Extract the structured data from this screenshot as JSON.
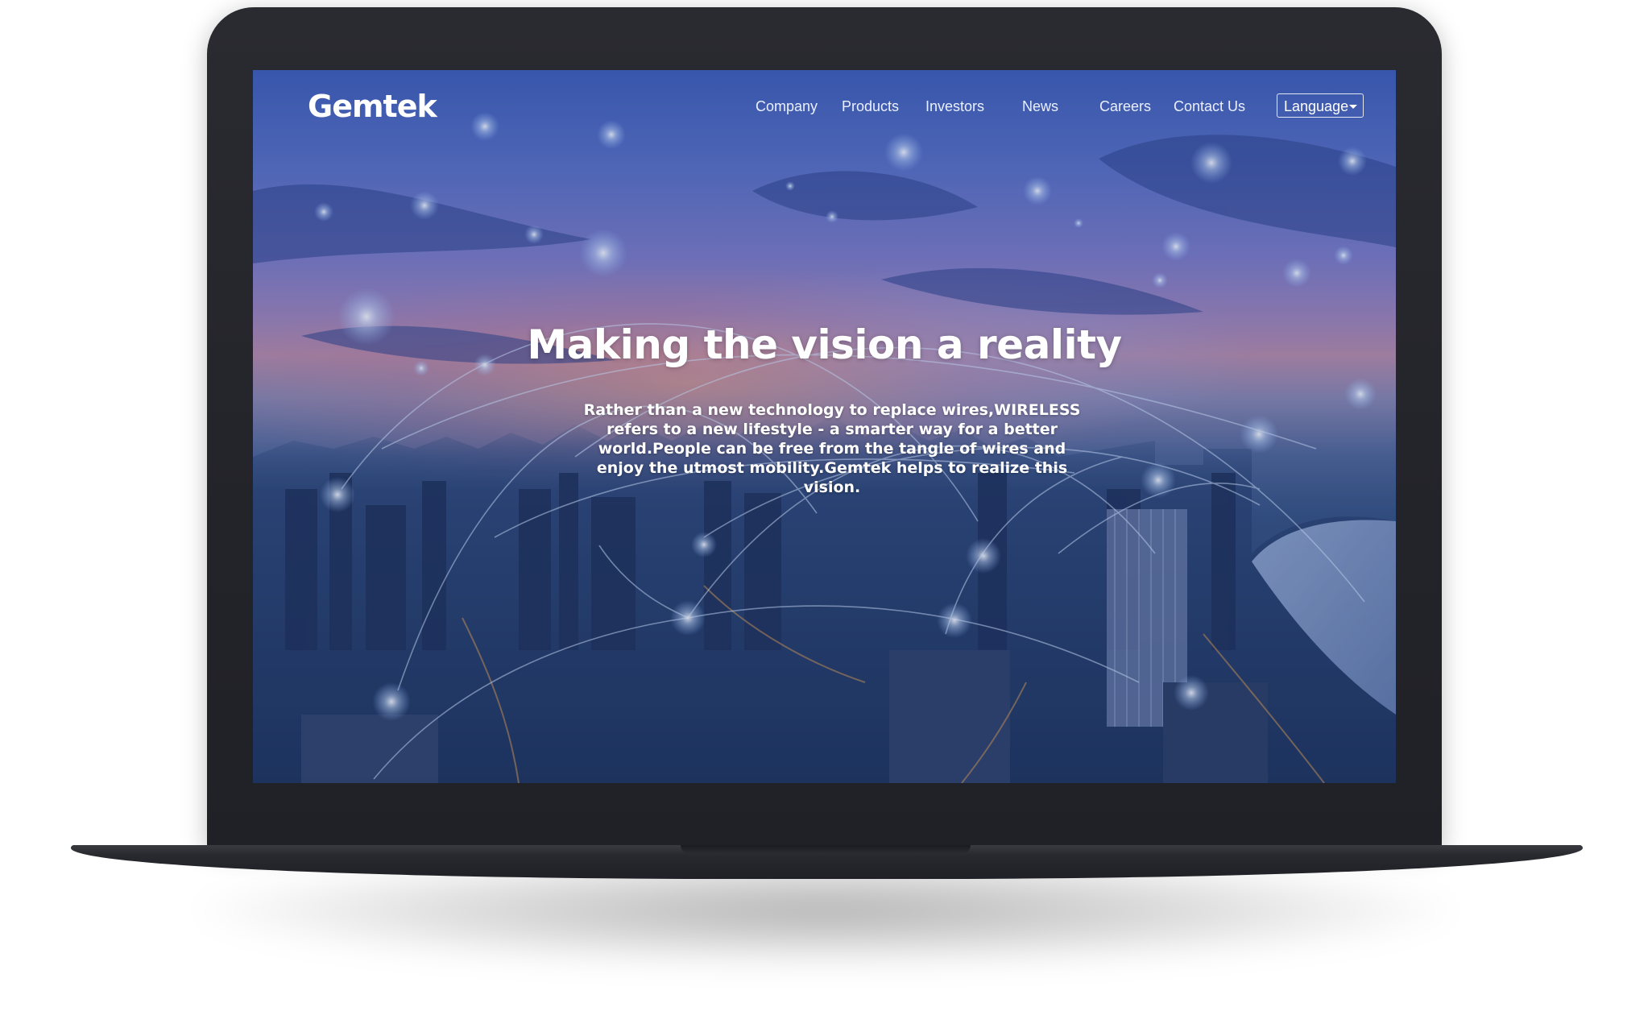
{
  "site": {
    "logo": "Gemtek"
  },
  "nav": {
    "items": [
      {
        "label": "Company"
      },
      {
        "label": "Products"
      },
      {
        "label": "Investors"
      },
      {
        "label": "News"
      },
      {
        "label": "Careers"
      },
      {
        "label": "Contact Us"
      }
    ],
    "language_label": "Language"
  },
  "hero": {
    "title": "Making the vision a reality",
    "body": "Rather than a new technology to replace wires,WIRELESS refers to a new lifestyle - a smarter way for a better world.People can be free from the tangle of wires and enjoy the utmost mobility.Gemtek helps to realize this vision."
  },
  "icons": {
    "language_caret": "caret-down-icon"
  },
  "colors": {
    "laptop_body": "#23242a",
    "hero_text": "#ffffff",
    "sky_top": "#3d5cb6",
    "sunset": "#b88aa6",
    "city_night": "#223a62"
  }
}
